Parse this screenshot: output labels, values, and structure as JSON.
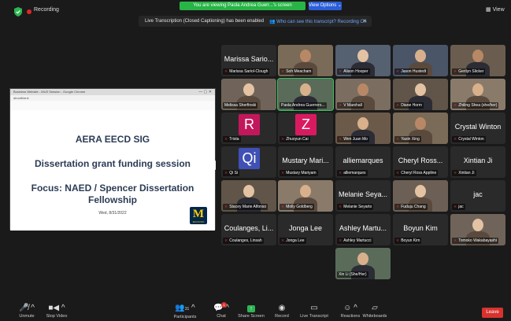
{
  "top": {
    "recording": "Recording",
    "viewing_banner": "You are viewing Paola Andrea Guerr...'s screen",
    "view_options": "View Options",
    "view": "View",
    "caption_text": "Live Transcription (Closed Captioning) has been enabled",
    "caption_link": "Who can see this transcript? Recording On",
    "caption_close": "×"
  },
  "share": {
    "window_title": "Business Website - MUS Session - Google Chrome",
    "url": "aboutblank",
    "line1": "AERA EECD SIG",
    "line2": "Dissertation grant funding session",
    "line3": "Focus: NAED / Spencer Dissertation",
    "line4": "Fellowship",
    "date": "Wed, 8/31/2022",
    "logo_letter": "M",
    "logo_sub": "EDUCATION"
  },
  "tiles": [
    {
      "name": "Marissa Sariol-Clough",
      "big": "Marissa Sario...",
      "muted": true
    },
    {
      "name": "Soh Meacham",
      "muted": true
    },
    {
      "name": "Alison Hooper",
      "muted": true
    },
    {
      "name": "Jason Hustedt",
      "muted": true
    },
    {
      "name": "Gerilyn Slicker",
      "muted": true
    },
    {
      "name": "Melissa Sherfinski",
      "muted": false
    },
    {
      "name": "Paola Andrea Guerrero...",
      "muted": false
    },
    {
      "name": "V Marshall",
      "muted": true
    },
    {
      "name": "Diane Horm",
      "muted": true
    },
    {
      "name": "Zhiling Shea (she/her)",
      "muted": true
    },
    {
      "name": "Trista",
      "letter": "R",
      "muted": true
    },
    {
      "name": "Zhuoyun Cai",
      "letter": "Z",
      "muted": true
    },
    {
      "name": "Wen Juan Mo",
      "muted": true
    },
    {
      "name": "Yaxin Xing",
      "muted": true
    },
    {
      "name": "Crystal Winton",
      "big": "Crystal Winton",
      "muted": true
    },
    {
      "name": "Qi Si",
      "letter": "Qi",
      "muted": true
    },
    {
      "name": "Mustary Mariyam",
      "big": "Mustary Mari...",
      "muted": true
    },
    {
      "name": "alliemarques",
      "big": "alliemarques",
      "muted": true
    },
    {
      "name": "Cheryl Ross Appline",
      "big": "Cheryl Ross...",
      "muted": true
    },
    {
      "name": "Xintian Ji",
      "big": "Xintian Ji",
      "muted": true
    },
    {
      "name": "Stacey Marie Alfonso",
      "muted": true
    },
    {
      "name": "Molly Goldberg",
      "muted": true
    },
    {
      "name": "Melanie Seyarto",
      "big": "Melanie Seya...",
      "muted": true
    },
    {
      "name": "Fuduju Chang",
      "muted": true
    },
    {
      "name": "jac",
      "big": "jac",
      "muted": true
    },
    {
      "name": "Coulanges, Linsah",
      "big": "Coulanges, Li...",
      "muted": true
    },
    {
      "name": "Jonga Lee",
      "big": "Jonga Lee",
      "muted": true
    },
    {
      "name": "Ashley Martucci",
      "big": "Ashley Martu...",
      "muted": true
    },
    {
      "name": "Boyun Kim",
      "big": "Boyun Kim",
      "muted": true
    },
    {
      "name": "Tomoko Wakabayashi",
      "muted": true
    },
    {
      "name": "Xin Li (She/Her)",
      "muted": false
    }
  ],
  "toolbar": {
    "unmute": "Unmute",
    "stop_video": "Stop Video",
    "participants": "Participants",
    "participants_count": "31",
    "chat": "Chat",
    "chat_badge": "1",
    "share_screen": "Share Screen",
    "record": "Record",
    "live_transcript": "Live Transcript",
    "reactions": "Reactions",
    "whiteboards": "Whiteboards",
    "leave": "Leave"
  },
  "colors": {
    "accent_green": "#28b446",
    "accent_blue": "#2b5ed8",
    "leave_red": "#d9322e",
    "tile_r": "#c2185b",
    "tile_z": "#d81b60",
    "tile_qi": "#3f51b5"
  }
}
